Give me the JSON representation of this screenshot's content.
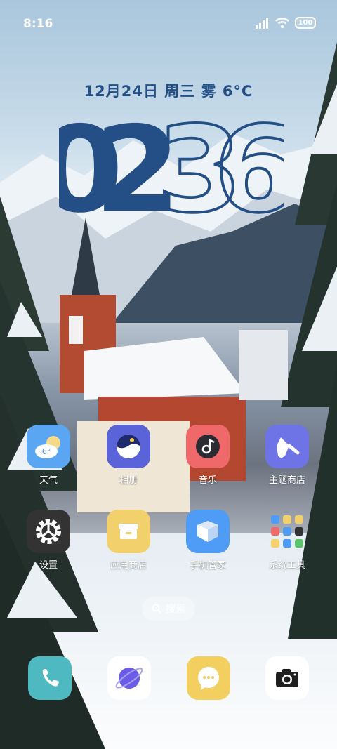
{
  "status_bar": {
    "time": "8:16",
    "battery": "100"
  },
  "widget": {
    "date": "12月24日 周三 雾 6°C",
    "clock_digits": [
      "0",
      "2",
      "3",
      "6"
    ]
  },
  "apps": [
    {
      "label": "天气",
      "icon": "weather-icon",
      "temp": "6°"
    },
    {
      "label": "相册",
      "icon": "gallery-icon"
    },
    {
      "label": "音乐",
      "icon": "music-icon"
    },
    {
      "label": "主题商店",
      "icon": "theme-store-icon"
    },
    {
      "label": "设置",
      "icon": "settings-icon"
    },
    {
      "label": "应用商店",
      "icon": "app-store-icon"
    },
    {
      "label": "手机管家",
      "icon": "phone-manager-icon"
    },
    {
      "label": "系统工具",
      "icon": "system-tools-folder-icon"
    }
  ],
  "search": {
    "label": "搜索"
  },
  "dock": [
    "phone-icon",
    "browser-icon",
    "messages-icon",
    "camera-icon"
  ],
  "colors": {
    "clock_blue": "#234f86",
    "weather": "#5aa6f2",
    "gallery": "#5a63d8",
    "music": "#f0696a",
    "theme": "#6e73e6",
    "settings": "#333333",
    "app_store": "#f2d06b",
    "phone_manager": "#4f9cf6",
    "phone": "#4fb9c2",
    "messages": "#f2cf5e"
  }
}
